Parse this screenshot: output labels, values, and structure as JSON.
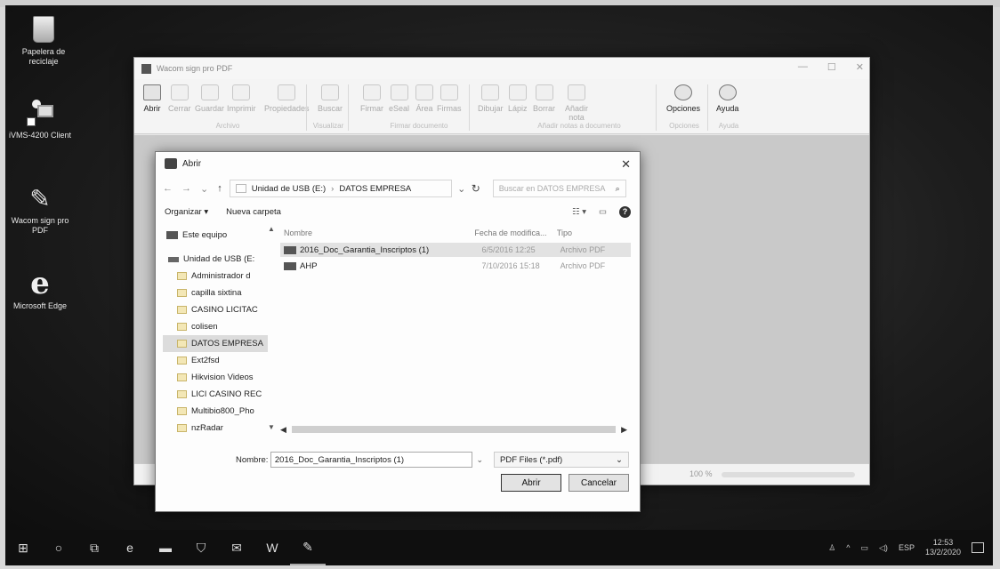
{
  "desktop": {
    "icons": [
      {
        "label": "Papelera de reciclaje",
        "icon": "recycle-bin-icon"
      },
      {
        "label": "iVMS-4200 Client",
        "icon": "ivms-icon"
      },
      {
        "label": "Wacom sign pro PDF",
        "icon": "wacom-pen-icon"
      },
      {
        "label": "Microsoft Edge",
        "icon": "edge-icon"
      }
    ]
  },
  "main_window": {
    "title": "Wacom sign pro PDF",
    "controls": [
      "—",
      "☐",
      "✕"
    ],
    "ribbon": {
      "buttons": [
        "Abrir",
        "Cerrar",
        "Guardar",
        "Imprimir",
        "Propiedades",
        "Buscar",
        "Firmar",
        "eSeal",
        "Área",
        "Firmas",
        "Dibujar",
        "Lápiz",
        "Borrar",
        "Añadir nota",
        "Opciones",
        "Ayuda"
      ],
      "groups": [
        "Archivo",
        "Visualizar",
        "Firmar documento",
        "Añadir notas a documento",
        "Opciones",
        "Ayuda"
      ]
    },
    "zoom_label": "100 %"
  },
  "dialog": {
    "title": "Abrir",
    "close": "✕",
    "address": {
      "drive": "Unidad de USB (E:)",
      "separator": "›",
      "folder": "DATOS EMPRESA"
    },
    "search_placeholder": "Buscar en DATOS EMPRESA",
    "toolbar": {
      "organize": "Organizar ▾",
      "new_folder": "Nueva carpeta",
      "help": "?"
    },
    "nav": {
      "this_pc": "Este equipo",
      "usb": "Unidad de USB (E:",
      "folders": [
        "Administrador d",
        "capilla sixtina",
        "CASINO LICITAC",
        "colisen",
        "DATOS EMPRESA",
        "Ext2fsd",
        "Hikvision Videos",
        "LICI CASINO REC",
        "Multibio800_Pho",
        "nzRadar"
      ]
    },
    "columns": {
      "name": "Nombre",
      "date": "Fecha de modifica...",
      "type": "Tipo"
    },
    "files": [
      {
        "name": "2016_Doc_Garantia_Inscriptos (1)",
        "date": "6/5/2016 12:25",
        "type": "Archivo PDF"
      },
      {
        "name": "AHP",
        "date": "7/10/2016 15:18",
        "type": "Archivo PDF"
      }
    ],
    "filename_label": "Nombre:",
    "filename_value": "2016_Doc_Garantia_Inscriptos (1)",
    "filetype": "PDF Files (*.pdf)",
    "open_button": "Abrir",
    "cancel_button": "Cancelar"
  },
  "taskbar": {
    "tray_lang": "ESP",
    "time": "12:53",
    "date": "13/2/2020"
  }
}
